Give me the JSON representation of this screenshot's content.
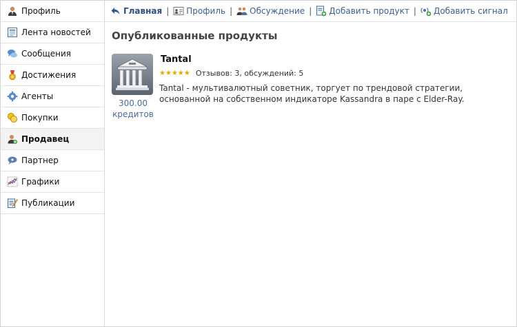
{
  "sidebar": {
    "items": [
      {
        "label": "Профиль",
        "icon": "profile-icon"
      },
      {
        "label": "Лента новостей",
        "icon": "newsfeed-icon"
      },
      {
        "label": "Сообщения",
        "icon": "messages-icon"
      },
      {
        "label": "Достижения",
        "icon": "achievements-icon"
      },
      {
        "label": "Агенты",
        "icon": "agents-icon"
      },
      {
        "label": "Покупки",
        "icon": "purchases-icon"
      },
      {
        "label": "Продавец",
        "icon": "seller-icon",
        "active": true
      },
      {
        "label": "Партнер",
        "icon": "partner-icon"
      },
      {
        "label": "Графики",
        "icon": "charts-icon"
      },
      {
        "label": "Публикации",
        "icon": "publications-icon"
      }
    ]
  },
  "topnav": {
    "home": "Главная",
    "profile": "Профиль",
    "discussion": "Обсуждение",
    "add_product": "Добавить продукт",
    "add_signal": "Добавить сигнал",
    "separator": "|"
  },
  "main": {
    "title": "Опубликованные продукты",
    "product": {
      "name": "Tantal",
      "rating_stars": 5,
      "stats": "Отзывов: 3, обсуждений: 5",
      "description": "Tantal - мультивалютный советник, торгует по трендовой стратегии, основанной на собственном индикаторе Kassandra в паре с Elder-Ray.",
      "price_value": "300.00",
      "price_unit": "кредитов"
    }
  }
}
